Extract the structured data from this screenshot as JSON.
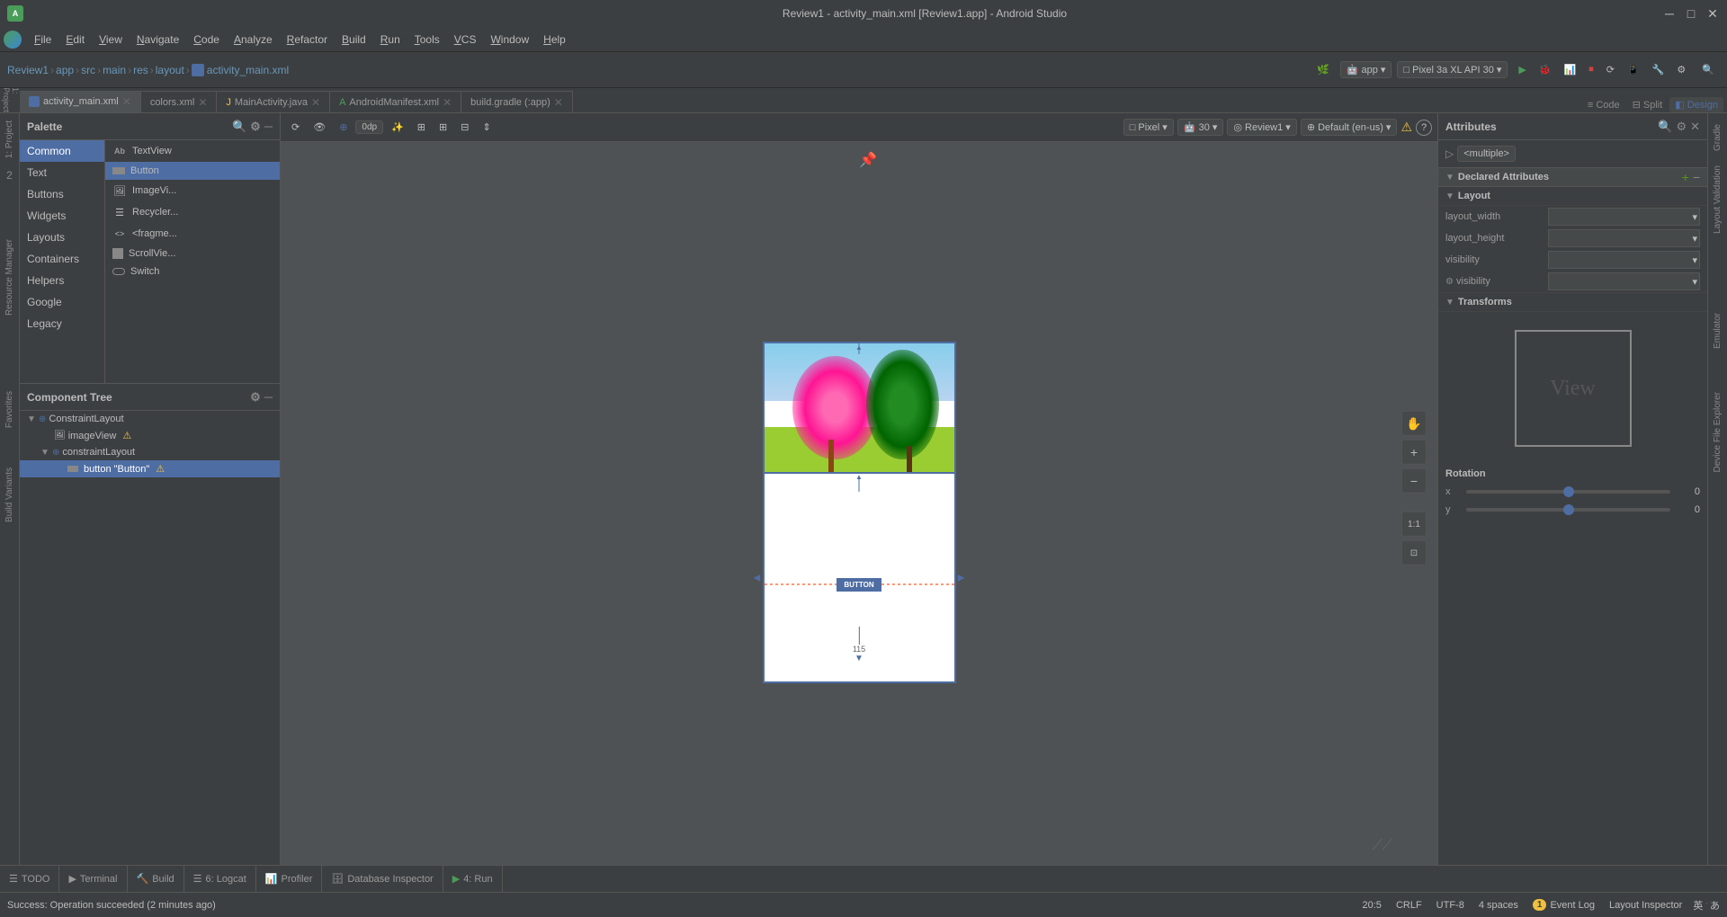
{
  "window": {
    "title": "Review1 - activity_main.xml [Review1.app] - Android Studio",
    "app_icon": "A"
  },
  "menu": {
    "items": [
      "File",
      "Edit",
      "View",
      "Navigate",
      "Code",
      "Analyze",
      "Refactor",
      "Build",
      "Run",
      "Tools",
      "VCS",
      "Window",
      "Help"
    ]
  },
  "breadcrumb": {
    "items": [
      "Review1",
      "app",
      "src",
      "main",
      "res",
      "layout",
      "activity_main.xml"
    ]
  },
  "tabs": {
    "items": [
      {
        "label": "activity_main.xml",
        "active": true
      },
      {
        "label": "colors.xml",
        "active": false
      },
      {
        "label": "MainActivity.java",
        "active": false
      },
      {
        "label": "AndroidManifest.xml",
        "active": false
      },
      {
        "label": "build.gradle (:app)",
        "active": false
      }
    ]
  },
  "view_modes": {
    "code": "Code",
    "split": "Split",
    "design": "Design"
  },
  "palette": {
    "title": "Palette",
    "categories": [
      {
        "label": "Common",
        "active": true
      },
      {
        "label": "Text"
      },
      {
        "label": "Buttons"
      },
      {
        "label": "Widgets"
      },
      {
        "label": "Layouts"
      },
      {
        "label": "Containers"
      },
      {
        "label": "Helpers"
      },
      {
        "label": "Google"
      },
      {
        "label": "Legacy"
      }
    ],
    "widgets": [
      {
        "label": "TextView",
        "icon": "Ab"
      },
      {
        "label": "Button",
        "icon": "▪",
        "active": true
      },
      {
        "label": "ImageVi...",
        "icon": "🖼"
      },
      {
        "label": "Recycler...",
        "icon": "☰"
      },
      {
        "label": "<fragme...",
        "icon": "<>"
      },
      {
        "label": "ScrollVie...",
        "icon": "▪"
      },
      {
        "label": "Switch",
        "icon": "⬜"
      }
    ]
  },
  "component_tree": {
    "title": "Component Tree",
    "items": [
      {
        "label": "ConstraintLayout",
        "level": 0,
        "icon": "◉",
        "has_arrow": true,
        "expanded": true
      },
      {
        "label": "imageView",
        "level": 1,
        "icon": "🖼",
        "warning": true
      },
      {
        "label": "constraintLayout",
        "level": 1,
        "icon": "◉",
        "has_arrow": true,
        "expanded": true
      },
      {
        "label": "button \"Button\"",
        "level": 2,
        "icon": "▪",
        "warning": true,
        "selected": true
      }
    ]
  },
  "canvas": {
    "toolbar": {
      "zoom_value": "0dp",
      "device": "Pixel",
      "api": "30",
      "project": "Review1",
      "locale": "Default (en-us)"
    },
    "button_text": "BUTTON",
    "measure_value": "115"
  },
  "attributes": {
    "title": "Attributes",
    "selected": "<multiple>",
    "declared_attributes_label": "Declared Attributes",
    "sections": {
      "layout": {
        "title": "Layout",
        "fields": [
          {
            "label": "layout_width",
            "value": ""
          },
          {
            "label": "layout_height",
            "value": ""
          },
          {
            "label": "visibility",
            "value": ""
          },
          {
            "label": "visibility",
            "value": ""
          }
        ]
      },
      "transforms": {
        "title": "Transforms"
      },
      "rotation": {
        "title": "Rotation",
        "x_value": "0",
        "y_value": "0"
      }
    }
  },
  "bottom_toolbar": {
    "items": [
      {
        "label": "TODO",
        "icon": "☰"
      },
      {
        "label": "Terminal",
        "icon": "▶"
      },
      {
        "label": "Build",
        "icon": "🔨"
      },
      {
        "label": "6: Logcat",
        "icon": "☰"
      },
      {
        "label": "Profiler",
        "icon": "📊"
      },
      {
        "label": "Database Inspector",
        "icon": "🗄"
      },
      {
        "label": "4: Run",
        "icon": "▶"
      }
    ]
  },
  "status_bar": {
    "message": "Success: Operation succeeded (2 minutes ago)",
    "position": "20:5",
    "line_ending": "CRLF",
    "encoding": "UTF-8",
    "indent": "4 spaces",
    "event_log_badge": "1",
    "event_log_label": "Event Log",
    "layout_inspector_label": "Layout Inspector"
  },
  "right_strip": {
    "items": [
      "Gradle",
      "Layout Validation",
      "Emulator",
      "Device File Explorer"
    ]
  }
}
